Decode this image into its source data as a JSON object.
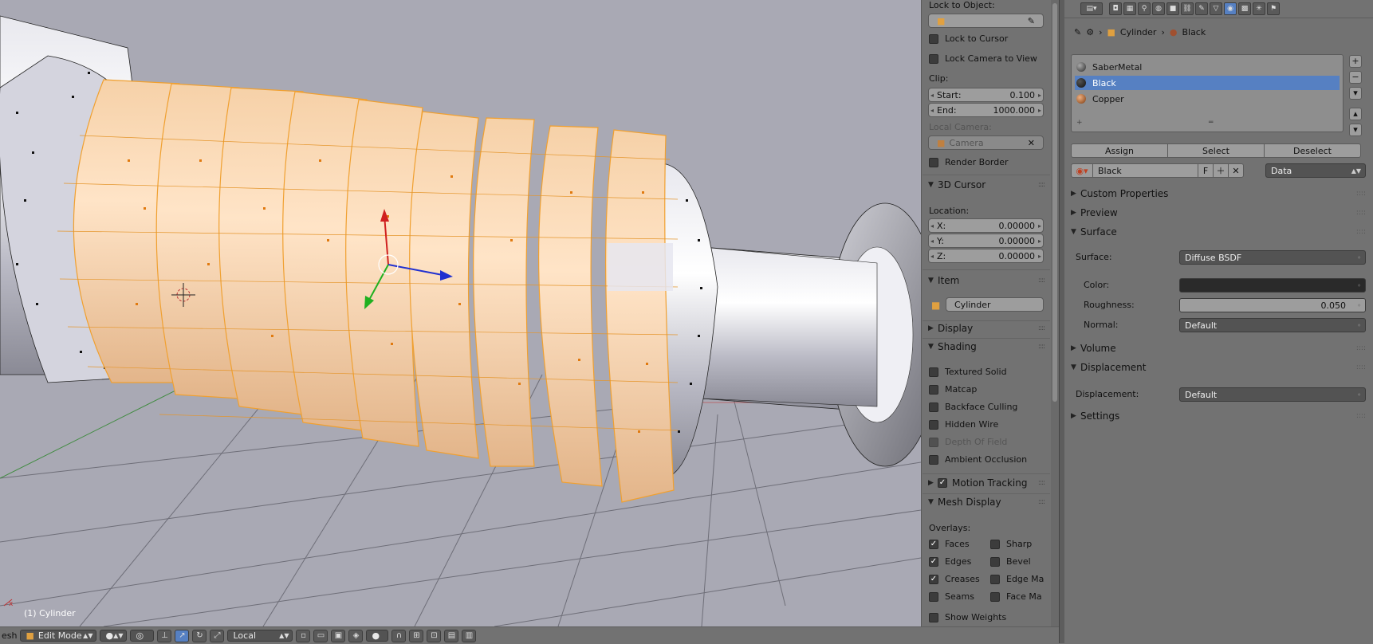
{
  "viewport": {
    "object_label": "(1) Cylinder"
  },
  "header": {
    "editor_fragment": "esh",
    "mode": "Edit Mode",
    "orientation": "Local"
  },
  "npanel": {
    "lock_to_object_label": "Lock to Object:",
    "lock_to_cursor": "Lock to Cursor",
    "lock_camera_to_view": "Lock Camera to View",
    "clip_label": "Clip:",
    "clip_start_label": "Start:",
    "clip_start_value": "0.100",
    "clip_end_label": "End:",
    "clip_end_value": "1000.000",
    "local_camera_label": "Local Camera:",
    "camera_placeholder": "Camera",
    "render_border": "Render Border",
    "cursor_section": "3D Cursor",
    "location_label": "Location:",
    "x_label": "X:",
    "x_value": "0.00000",
    "y_label": "Y:",
    "y_value": "0.00000",
    "z_label": "Z:",
    "z_value": "0.00000",
    "item_section": "Item",
    "item_name": "Cylinder",
    "display_section": "Display",
    "shading_section": "Shading",
    "shading_opts": [
      "Textured Solid",
      "Matcap",
      "Backface Culling",
      "Hidden Wire",
      "Depth Of Field",
      "Ambient Occlusion"
    ],
    "motion_tracking": "Motion Tracking",
    "mesh_display_section": "Mesh Display",
    "overlays_label": "Overlays:",
    "overlay_left": [
      "Faces",
      "Edges",
      "Creases",
      "Seams"
    ],
    "overlay_right": [
      "Sharp",
      "Bevel",
      "Edge Ma",
      "Face Ma"
    ],
    "show_weights": "Show Weights"
  },
  "props": {
    "crumb_object": "Cylinder",
    "crumb_material": "Black",
    "materials": [
      {
        "name": "SaberMetal",
        "color": "#2b2b2b"
      },
      {
        "name": "Black",
        "color": "#111111"
      },
      {
        "name": "Copper",
        "color": "#a0522d"
      }
    ],
    "assign": "Assign",
    "select": "Select",
    "deselect": "Deselect",
    "material_name": "Black",
    "fake_user": "F",
    "link": "Data",
    "custom_properties": "Custom Properties",
    "preview": "Preview",
    "surface_section": "Surface",
    "surface_label": "Surface:",
    "surface_value": "Diffuse BSDF",
    "color_label": "Color:",
    "color_value": "#2a2a2a",
    "roughness_label": "Roughness:",
    "roughness_value": "0.050",
    "normal_label": "Normal:",
    "normal_value": "Default",
    "volume_section": "Volume",
    "displacement_section": "Displacement",
    "displacement_label": "Displacement:",
    "displacement_value": "Default",
    "settings_section": "Settings"
  },
  "colors": {
    "accent": "#5680c2",
    "selection": "#f0a030",
    "viewport_bg": "#a9a9b4"
  }
}
